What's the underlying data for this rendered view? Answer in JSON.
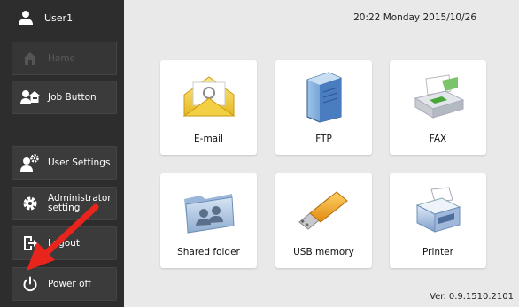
{
  "sidebar": {
    "user": {
      "name": "User1",
      "icon": "user-icon"
    },
    "items": [
      {
        "label": "Home",
        "icon": "home-icon",
        "enabled": false
      },
      {
        "label": "Job Button",
        "icon": "job-button-icon",
        "enabled": true
      },
      {
        "label": "User Settings",
        "icon": "user-settings-icon",
        "enabled": true
      },
      {
        "label": "Administrator setting",
        "icon": "gear-icon",
        "enabled": true
      },
      {
        "label": "Logout",
        "icon": "logout-icon",
        "enabled": true
      },
      {
        "label": "Power off",
        "icon": "power-icon",
        "enabled": true
      }
    ]
  },
  "header": {
    "datetime": "20:22 Monday 2015/10/26"
  },
  "tiles": [
    {
      "label": "E-mail",
      "icon": "email-envelope-icon"
    },
    {
      "label": "FTP",
      "icon": "ftp-server-icon"
    },
    {
      "label": "FAX",
      "icon": "fax-machine-icon"
    },
    {
      "label": "Shared folder",
      "icon": "shared-folder-icon"
    },
    {
      "label": "USB memory",
      "icon": "usb-memory-icon"
    },
    {
      "label": "Printer",
      "icon": "printer-icon"
    }
  ],
  "footer": {
    "version": "Ver. 0.9.1510.2101"
  },
  "annotation": {
    "arrow_color": "#e8241d",
    "icon": "red-arrow-icon"
  },
  "colors": {
    "sidebar_bg": "#2d2d2d",
    "button_bg": "#3b3b3b",
    "main_bg": "#e9e9e9",
    "tile_bg": "#ffffff"
  }
}
